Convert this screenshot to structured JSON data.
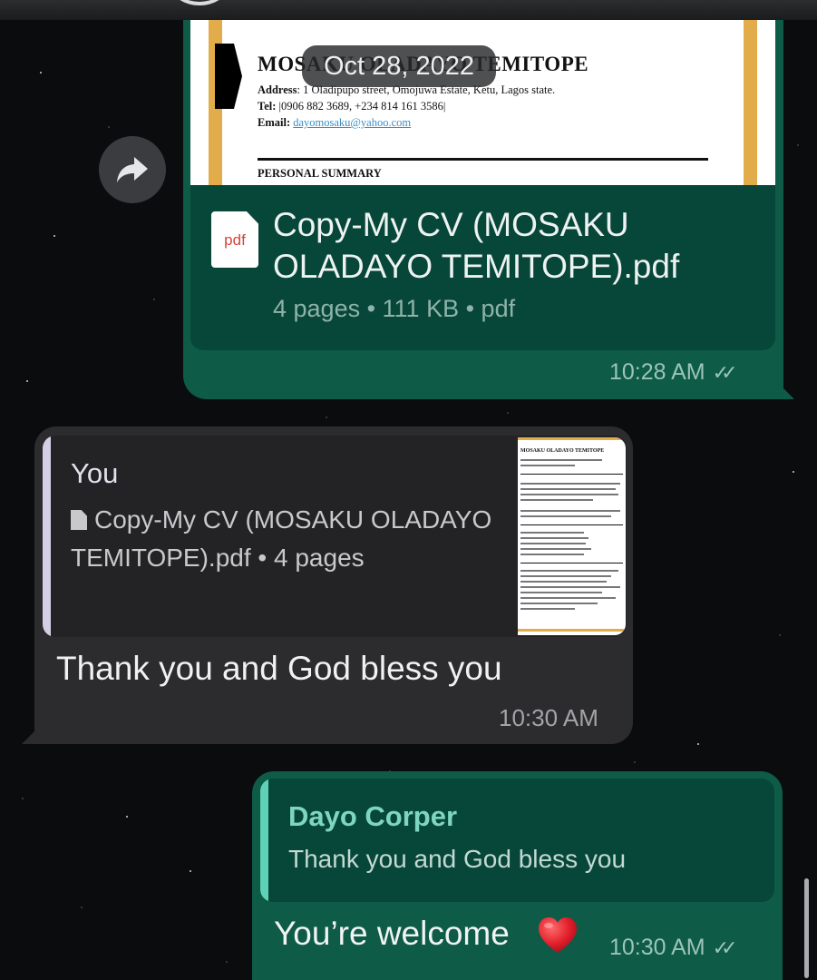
{
  "date_chip": "Oct 28, 2022",
  "document_message": {
    "preview": {
      "name": "MOSAKU OLADAYO TEMITOPE",
      "address_label": "Address",
      "address": ": 1 Oladipupo street, Omojuwa Estate, Ketu, Lagos state.",
      "tel_label": "Tel:",
      "tel": " |0906 882 3689, +234 814 161 3586|",
      "email_label": "Email:",
      "email": "dayomosaku@yahoo.com",
      "section": "PERSONAL SUMMARY"
    },
    "file_type_badge": "pdf",
    "file_name": "Copy-My CV (MOSAKU OLADAYO TEMITOPE).pdf",
    "file_meta": "4 pages • 111 KB • pdf",
    "time": "10:28 AM",
    "ticks": "✓✓"
  },
  "incoming_message": {
    "quote_author": "You",
    "quote_text": "Copy-My CV (MOSAKU OLADAYO TEMITOPE).pdf • 4 pages",
    "thumb_title": "MOSAKU OLADAYO TEMITOPE",
    "text": "Thank you and God bless you",
    "time": "10:30 AM"
  },
  "reply_message": {
    "quote_author": "Dayo Corper",
    "quote_text": "Thank you and God bless you",
    "text": "You’re welcome",
    "emoji": "heart-icon",
    "time": "10:30 AM",
    "ticks": "✓✓"
  },
  "icons": {
    "forward": "forward-icon",
    "pdf": "pdf-file-icon",
    "document": "document-icon",
    "read_receipt": "double-check-icon"
  },
  "colors": {
    "outgoing_bubble": "#0e5b48",
    "incoming_bubble": "#2c2c2e",
    "reply_accent": "#5fd1b4",
    "pdf_red": "#d6453a",
    "cv_accent": "#e2ac4b"
  }
}
